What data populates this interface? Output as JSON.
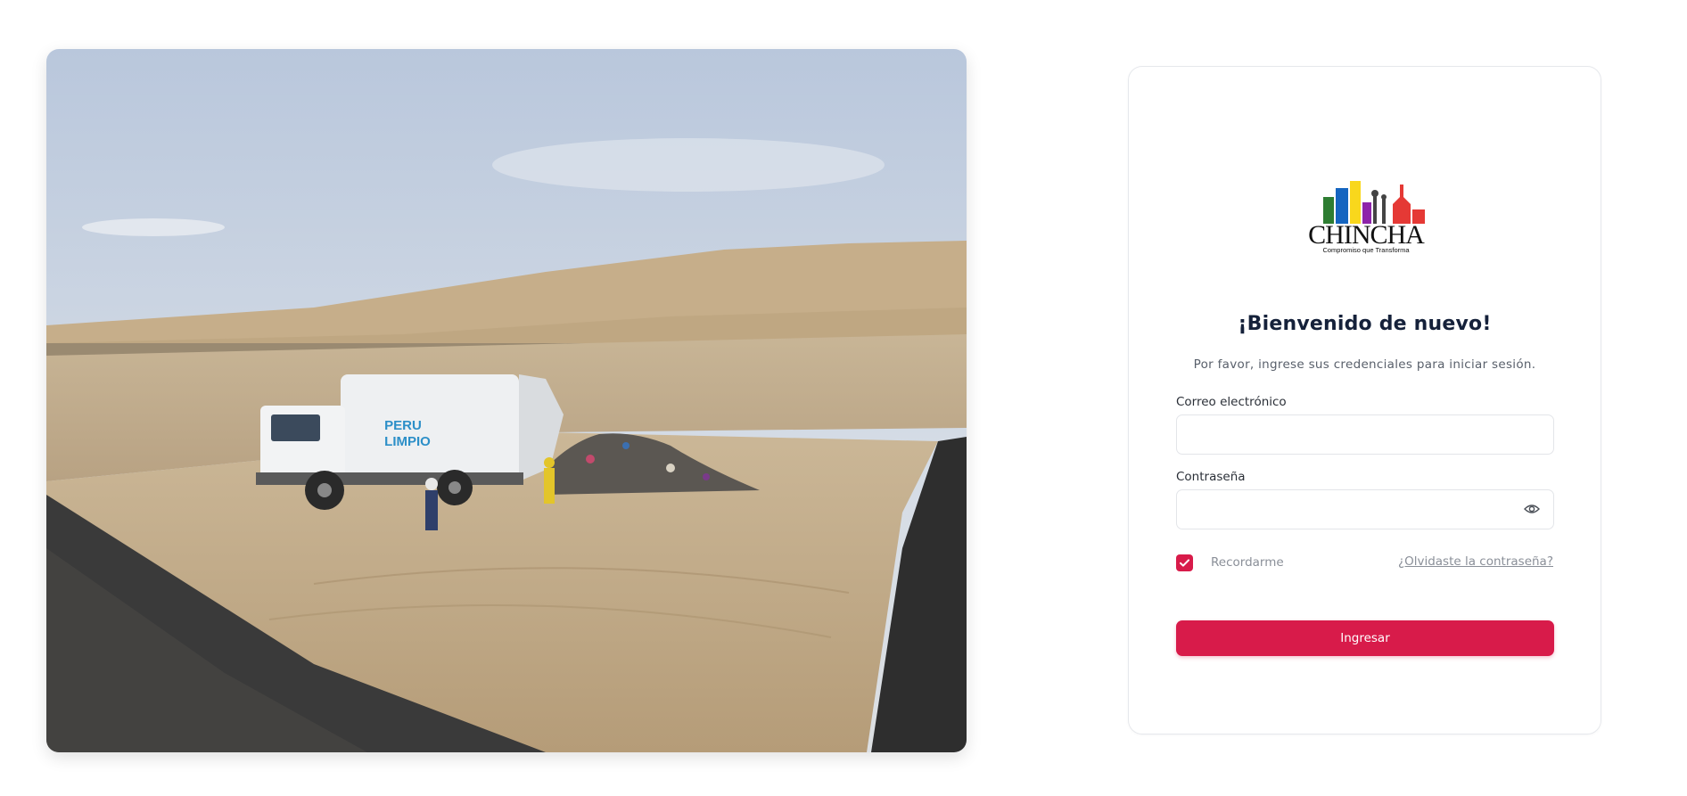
{
  "hero": {
    "truck_text_line1": "PERU",
    "truck_text_line2": "LIMPIO"
  },
  "logo": {
    "name": "CHINCHA",
    "tagline": "Compromiso que Transforma"
  },
  "login": {
    "title": "¡Bienvenido de nuevo!",
    "subtitle": "Por favor, ingrese sus credenciales para iniciar sesión.",
    "email_label": "Correo electrónico",
    "email_value": "",
    "password_label": "Contraseña",
    "password_value": "",
    "remember_label": "Recordarme",
    "remember_checked": true,
    "forgot_link": "¿Olvidaste la contraseña?",
    "submit_label": "Ingresar"
  },
  "icons": {
    "password_toggle": "eye-icon",
    "remember": "checkmark-icon"
  },
  "colors": {
    "accent": "#d81b4a",
    "title": "#15213a",
    "muted": "#8a8f98"
  }
}
